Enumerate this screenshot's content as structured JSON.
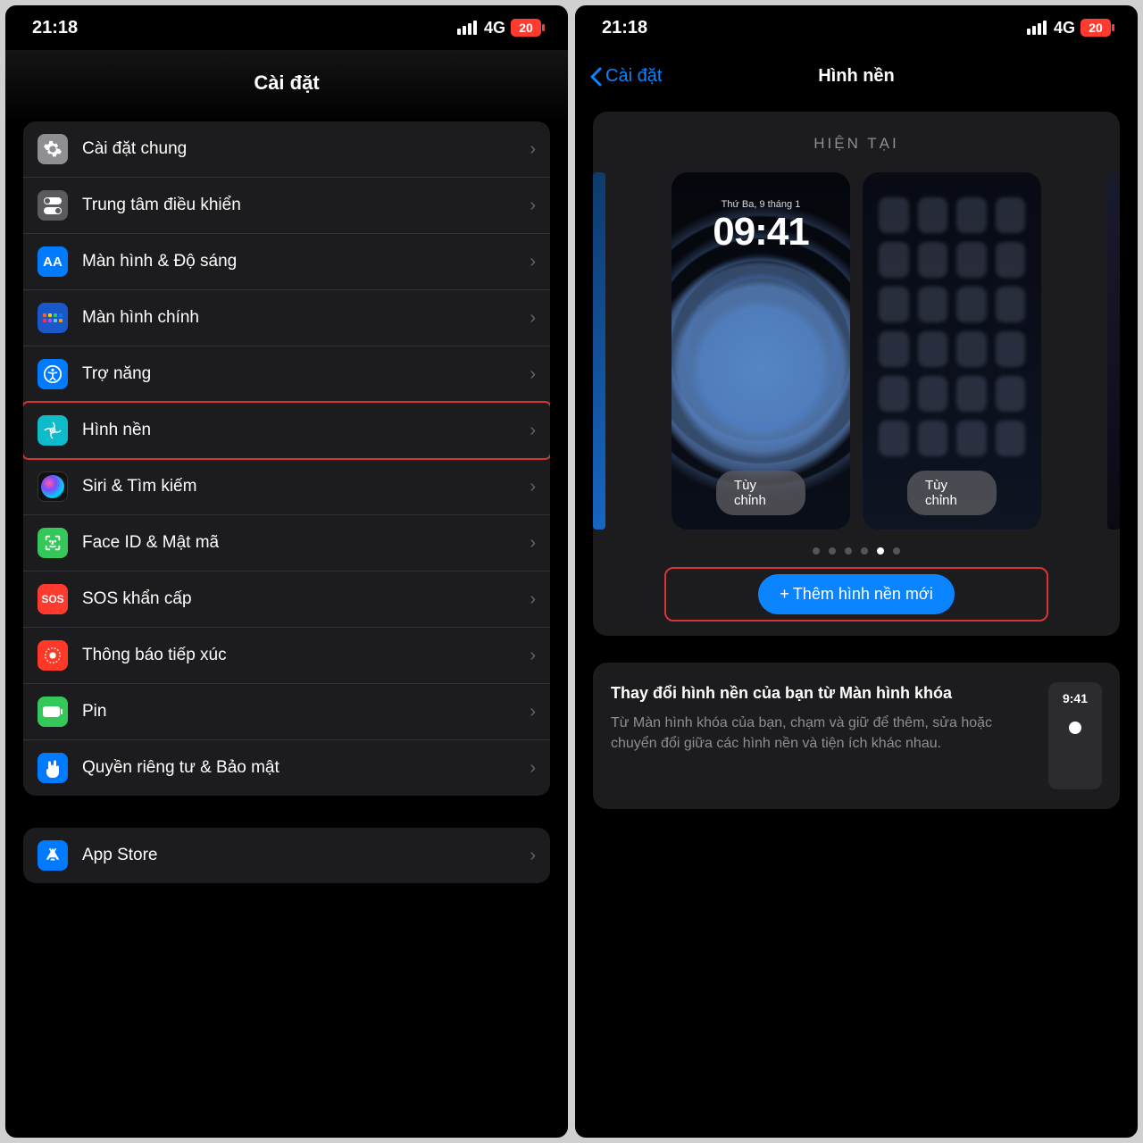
{
  "status": {
    "time": "21:18",
    "network_type": "4G",
    "battery": "20"
  },
  "left": {
    "title": "Cài đặt",
    "items": [
      {
        "label": "Cài đặt chung",
        "icon_name": "gear-icon",
        "bg": "ico-gray"
      },
      {
        "label": "Trung tâm điều khiển",
        "icon_name": "toggles-icon",
        "bg": "ico-gray2"
      },
      {
        "label": "Màn hình & Độ sáng",
        "icon_name": "display-aa-icon",
        "bg": "ico-blue"
      },
      {
        "label": "Màn hình chính",
        "icon_name": "home-grid-icon",
        "bg": "ico-darkblue"
      },
      {
        "label": "Trợ năng",
        "icon_name": "accessibility-icon",
        "bg": "ico-blue"
      },
      {
        "label": "Hình nền",
        "icon_name": "wallpaper-icon",
        "bg": "ico-cyan",
        "highlighted": true
      },
      {
        "label": "Siri & Tìm kiếm",
        "icon_name": "siri-icon",
        "bg": "ico-black"
      },
      {
        "label": "Face ID & Mật mã",
        "icon_name": "faceid-icon",
        "bg": "ico-green"
      },
      {
        "label": "SOS khẩn cấp",
        "icon_name": "sos-icon",
        "bg": "ico-red",
        "icon_text": "SOS"
      },
      {
        "label": "Thông báo tiếp xúc",
        "icon_name": "exposure-icon",
        "bg": "ico-orange"
      },
      {
        "label": "Pin",
        "icon_name": "battery-icon",
        "bg": "ico-green"
      },
      {
        "label": "Quyền riêng tư & Bảo mật",
        "icon_name": "privacy-hand-icon",
        "bg": "ico-blue"
      }
    ],
    "group2": [
      {
        "label": "App Store",
        "icon_name": "appstore-icon",
        "bg": "ico-blue"
      }
    ]
  },
  "right": {
    "back": "Cài đặt",
    "title": "Hình nền",
    "current_label": "HIỆN TẠI",
    "lock_date": "Thứ Ba, 9 tháng 1",
    "lock_time": "09:41",
    "customize": "Tùy chỉnh",
    "add_button": "Thêm hình nền mới",
    "dot_count": 6,
    "active_dot": 4,
    "info_title": "Thay đổi hình nền của bạn từ Màn hình khóa",
    "info_desc": "Từ Màn hình khóa của bạn, chạm và giữ để thêm, sửa hoặc chuyển đổi giữa các hình nền và tiện ích khác nhau.",
    "mini_time": "9:41"
  }
}
